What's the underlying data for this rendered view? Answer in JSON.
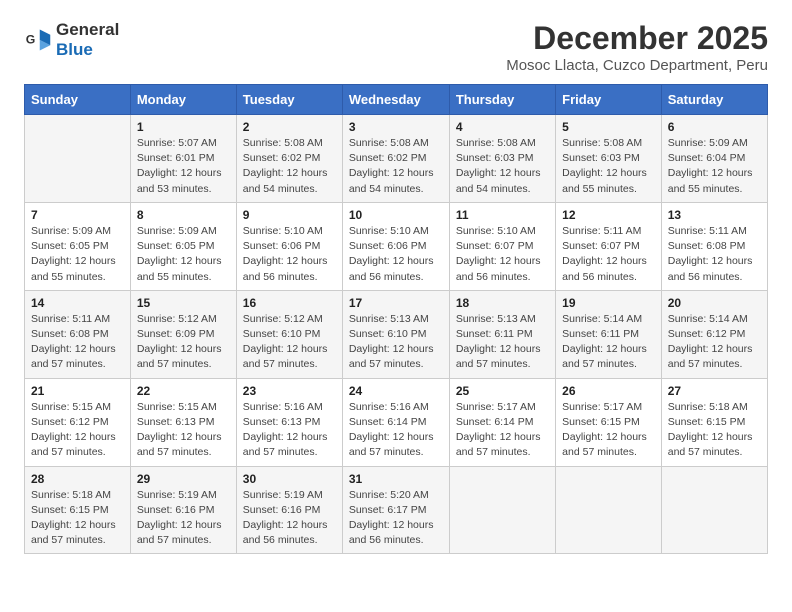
{
  "logo": {
    "general": "General",
    "blue": "Blue"
  },
  "title": "December 2025",
  "subtitle": "Mosoc Llacta, Cuzco Department, Peru",
  "header_days": [
    "Sunday",
    "Monday",
    "Tuesday",
    "Wednesday",
    "Thursday",
    "Friday",
    "Saturday"
  ],
  "weeks": [
    [
      {
        "day": "",
        "info": ""
      },
      {
        "day": "1",
        "info": "Sunrise: 5:07 AM\nSunset: 6:01 PM\nDaylight: 12 hours\nand 53 minutes."
      },
      {
        "day": "2",
        "info": "Sunrise: 5:08 AM\nSunset: 6:02 PM\nDaylight: 12 hours\nand 54 minutes."
      },
      {
        "day": "3",
        "info": "Sunrise: 5:08 AM\nSunset: 6:02 PM\nDaylight: 12 hours\nand 54 minutes."
      },
      {
        "day": "4",
        "info": "Sunrise: 5:08 AM\nSunset: 6:03 PM\nDaylight: 12 hours\nand 54 minutes."
      },
      {
        "day": "5",
        "info": "Sunrise: 5:08 AM\nSunset: 6:03 PM\nDaylight: 12 hours\nand 55 minutes."
      },
      {
        "day": "6",
        "info": "Sunrise: 5:09 AM\nSunset: 6:04 PM\nDaylight: 12 hours\nand 55 minutes."
      }
    ],
    [
      {
        "day": "7",
        "info": "Sunrise: 5:09 AM\nSunset: 6:05 PM\nDaylight: 12 hours\nand 55 minutes."
      },
      {
        "day": "8",
        "info": "Sunrise: 5:09 AM\nSunset: 6:05 PM\nDaylight: 12 hours\nand 55 minutes."
      },
      {
        "day": "9",
        "info": "Sunrise: 5:10 AM\nSunset: 6:06 PM\nDaylight: 12 hours\nand 56 minutes."
      },
      {
        "day": "10",
        "info": "Sunrise: 5:10 AM\nSunset: 6:06 PM\nDaylight: 12 hours\nand 56 minutes."
      },
      {
        "day": "11",
        "info": "Sunrise: 5:10 AM\nSunset: 6:07 PM\nDaylight: 12 hours\nand 56 minutes."
      },
      {
        "day": "12",
        "info": "Sunrise: 5:11 AM\nSunset: 6:07 PM\nDaylight: 12 hours\nand 56 minutes."
      },
      {
        "day": "13",
        "info": "Sunrise: 5:11 AM\nSunset: 6:08 PM\nDaylight: 12 hours\nand 56 minutes."
      }
    ],
    [
      {
        "day": "14",
        "info": "Sunrise: 5:11 AM\nSunset: 6:08 PM\nDaylight: 12 hours\nand 57 minutes."
      },
      {
        "day": "15",
        "info": "Sunrise: 5:12 AM\nSunset: 6:09 PM\nDaylight: 12 hours\nand 57 minutes."
      },
      {
        "day": "16",
        "info": "Sunrise: 5:12 AM\nSunset: 6:10 PM\nDaylight: 12 hours\nand 57 minutes."
      },
      {
        "day": "17",
        "info": "Sunrise: 5:13 AM\nSunset: 6:10 PM\nDaylight: 12 hours\nand 57 minutes."
      },
      {
        "day": "18",
        "info": "Sunrise: 5:13 AM\nSunset: 6:11 PM\nDaylight: 12 hours\nand 57 minutes."
      },
      {
        "day": "19",
        "info": "Sunrise: 5:14 AM\nSunset: 6:11 PM\nDaylight: 12 hours\nand 57 minutes."
      },
      {
        "day": "20",
        "info": "Sunrise: 5:14 AM\nSunset: 6:12 PM\nDaylight: 12 hours\nand 57 minutes."
      }
    ],
    [
      {
        "day": "21",
        "info": "Sunrise: 5:15 AM\nSunset: 6:12 PM\nDaylight: 12 hours\nand 57 minutes."
      },
      {
        "day": "22",
        "info": "Sunrise: 5:15 AM\nSunset: 6:13 PM\nDaylight: 12 hours\nand 57 minutes."
      },
      {
        "day": "23",
        "info": "Sunrise: 5:16 AM\nSunset: 6:13 PM\nDaylight: 12 hours\nand 57 minutes."
      },
      {
        "day": "24",
        "info": "Sunrise: 5:16 AM\nSunset: 6:14 PM\nDaylight: 12 hours\nand 57 minutes."
      },
      {
        "day": "25",
        "info": "Sunrise: 5:17 AM\nSunset: 6:14 PM\nDaylight: 12 hours\nand 57 minutes."
      },
      {
        "day": "26",
        "info": "Sunrise: 5:17 AM\nSunset: 6:15 PM\nDaylight: 12 hours\nand 57 minutes."
      },
      {
        "day": "27",
        "info": "Sunrise: 5:18 AM\nSunset: 6:15 PM\nDaylight: 12 hours\nand 57 minutes."
      }
    ],
    [
      {
        "day": "28",
        "info": "Sunrise: 5:18 AM\nSunset: 6:15 PM\nDaylight: 12 hours\nand 57 minutes."
      },
      {
        "day": "29",
        "info": "Sunrise: 5:19 AM\nSunset: 6:16 PM\nDaylight: 12 hours\nand 57 minutes."
      },
      {
        "day": "30",
        "info": "Sunrise: 5:19 AM\nSunset: 6:16 PM\nDaylight: 12 hours\nand 56 minutes."
      },
      {
        "day": "31",
        "info": "Sunrise: 5:20 AM\nSunset: 6:17 PM\nDaylight: 12 hours\nand 56 minutes."
      },
      {
        "day": "",
        "info": ""
      },
      {
        "day": "",
        "info": ""
      },
      {
        "day": "",
        "info": ""
      }
    ]
  ]
}
